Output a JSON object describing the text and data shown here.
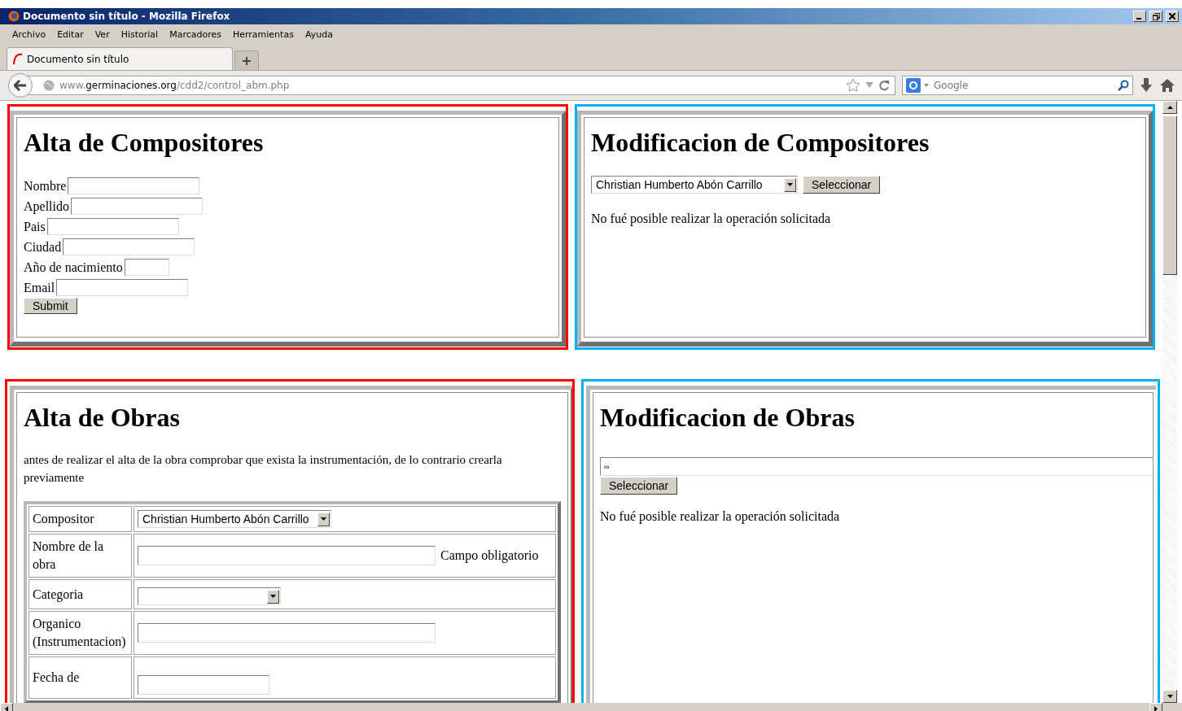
{
  "window": {
    "title": "Documento sin título - Mozilla Firefox"
  },
  "menu": [
    "Archivo",
    "Editar",
    "Ver",
    "Historial",
    "Marcadores",
    "Herramientas",
    "Ayuda"
  ],
  "tabs": [
    {
      "label": "Documento sin título",
      "selected": true
    }
  ],
  "address": {
    "prefix": "www.",
    "domain": "germinaciones.org",
    "path": "/cdd2/control_abm.php"
  },
  "search": {
    "placeholder": "Google"
  },
  "panels": [
    {
      "kind": "alta_compositores",
      "title": "Alta de Compositores",
      "color": "#ff0000",
      "fields": [
        {
          "label": "Nombre",
          "kind": "text"
        },
        {
          "label": "Apellido",
          "kind": "text"
        },
        {
          "label": "Pais",
          "kind": "text"
        },
        {
          "label": "Ciudad",
          "kind": "text"
        },
        {
          "label": "Año de nacimiento",
          "kind": "year"
        },
        {
          "label": "Email",
          "kind": "text"
        }
      ],
      "button": "Submit"
    },
    {
      "kind": "modificacion_compositores",
      "title": "Modificacion de Compositores",
      "color": "#00b0f0",
      "select_value": "Christian Humberto Abón Carrillo",
      "button": "Seleccionar",
      "message": "No fué posible realizar la operación solicitada"
    },
    {
      "kind": "alta_obras",
      "title": "Alta de Obras",
      "color": "#ff0000",
      "intro": "antes de realizar el alta de la obra comprobar que exista la instrumentación, de lo contrario crearla previamente",
      "rows": [
        {
          "label": "Compositor",
          "kind": "select",
          "value": "Christian Humberto Abón Carrillo"
        },
        {
          "label": "Nombre de la obra",
          "kind": "text",
          "note": "Campo obligatorio"
        },
        {
          "label": "Categoria",
          "kind": "select"
        },
        {
          "label": "Organico (Instrumentacion)",
          "kind": "text"
        },
        {
          "label": "Fecha de",
          "kind": "date"
        }
      ]
    },
    {
      "kind": "modificacion_obras",
      "title": "Modificacion de Obras",
      "color": "#00b0f0",
      "input_value": "∞",
      "button": "Seleccionar",
      "message": "No fué posible realizar la operación solicitada"
    }
  ]
}
